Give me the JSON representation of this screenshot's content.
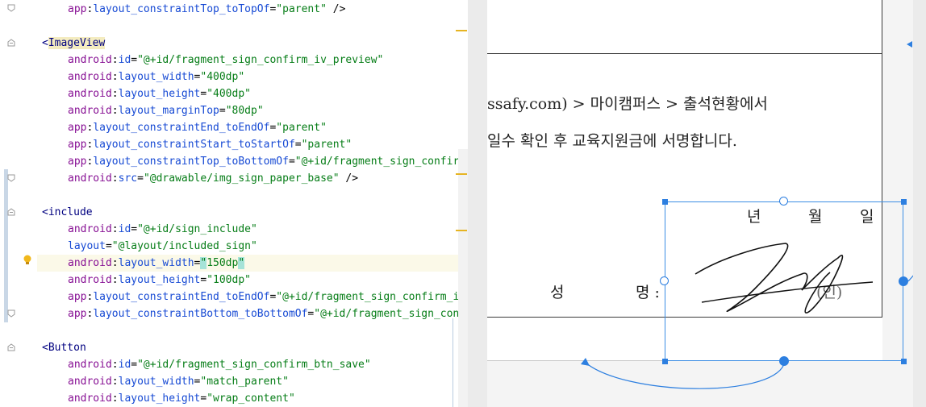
{
  "editor": {
    "lines": [
      {
        "indent": 1,
        "parts": [
          [
            "ns",
            "app"
          ],
          [
            "punct",
            ":"
          ],
          [
            "attr",
            "layout_constraintTop_toTopOf"
          ],
          [
            "punct",
            "="
          ],
          [
            "val",
            "\"parent\""
          ],
          [
            "punct",
            " />"
          ]
        ]
      },
      {
        "indent": 0,
        "parts": []
      },
      {
        "indent": 0,
        "parts": [
          [
            "tag-open",
            "<"
          ],
          [
            "tag-name-sel",
            "ImageView"
          ]
        ]
      },
      {
        "indent": 1,
        "parts": [
          [
            "ns",
            "android"
          ],
          [
            "punct",
            ":"
          ],
          [
            "attr",
            "id"
          ],
          [
            "punct",
            "="
          ],
          [
            "val",
            "\"@+id/fragment_sign_confirm_iv_preview\""
          ]
        ]
      },
      {
        "indent": 1,
        "parts": [
          [
            "ns",
            "android"
          ],
          [
            "punct",
            ":"
          ],
          [
            "attr",
            "layout_width"
          ],
          [
            "punct",
            "="
          ],
          [
            "val",
            "\"400dp\""
          ]
        ]
      },
      {
        "indent": 1,
        "parts": [
          [
            "ns",
            "android"
          ],
          [
            "punct",
            ":"
          ],
          [
            "attr",
            "layout_height"
          ],
          [
            "punct",
            "="
          ],
          [
            "val",
            "\"400dp\""
          ]
        ]
      },
      {
        "indent": 1,
        "parts": [
          [
            "ns",
            "android"
          ],
          [
            "punct",
            ":"
          ],
          [
            "attr",
            "layout_marginTop"
          ],
          [
            "punct",
            "="
          ],
          [
            "val",
            "\"80dp\""
          ]
        ]
      },
      {
        "indent": 1,
        "parts": [
          [
            "ns",
            "app"
          ],
          [
            "punct",
            ":"
          ],
          [
            "attr",
            "layout_constraintEnd_toEndOf"
          ],
          [
            "punct",
            "="
          ],
          [
            "val",
            "\"parent\""
          ]
        ]
      },
      {
        "indent": 1,
        "parts": [
          [
            "ns",
            "app"
          ],
          [
            "punct",
            ":"
          ],
          [
            "attr",
            "layout_constraintStart_toStartOf"
          ],
          [
            "punct",
            "="
          ],
          [
            "val",
            "\"parent\""
          ]
        ]
      },
      {
        "indent": 1,
        "parts": [
          [
            "ns",
            "app"
          ],
          [
            "punct",
            ":"
          ],
          [
            "attr",
            "layout_constraintTop_toBottomOf"
          ],
          [
            "punct",
            "="
          ],
          [
            "val",
            "\"@+id/fragment_sign_confir"
          ]
        ]
      },
      {
        "indent": 1,
        "parts": [
          [
            "ns",
            "android"
          ],
          [
            "punct",
            ":"
          ],
          [
            "attr",
            "src"
          ],
          [
            "punct",
            "="
          ],
          [
            "val",
            "\"@drawable/img_sign_paper_base\""
          ],
          [
            "punct",
            " />"
          ]
        ]
      },
      {
        "indent": 0,
        "parts": []
      },
      {
        "indent": 0,
        "parts": [
          [
            "tag-open",
            "<"
          ],
          [
            "tag-name",
            "include"
          ]
        ]
      },
      {
        "indent": 1,
        "parts": [
          [
            "ns",
            "android"
          ],
          [
            "punct",
            ":"
          ],
          [
            "attr",
            "id"
          ],
          [
            "punct",
            "="
          ],
          [
            "val",
            "\"@+id/sign_include\""
          ]
        ]
      },
      {
        "indent": 1,
        "parts": [
          [
            "attr",
            "layout"
          ],
          [
            "punct",
            "="
          ],
          [
            "val",
            "\"@layout/included_sign\""
          ]
        ]
      },
      {
        "indent": 1,
        "hl": true,
        "parts": [
          [
            "ns",
            "android"
          ],
          [
            "punct",
            ":"
          ],
          [
            "attr",
            "layout_width"
          ],
          [
            "punct",
            "="
          ],
          [
            "val-bm",
            "\"150dp\""
          ]
        ]
      },
      {
        "indent": 1,
        "parts": [
          [
            "ns",
            "android"
          ],
          [
            "punct",
            ":"
          ],
          [
            "attr",
            "layout_height"
          ],
          [
            "punct",
            "="
          ],
          [
            "val",
            "\"100dp\""
          ]
        ]
      },
      {
        "indent": 1,
        "parts": [
          [
            "ns",
            "app"
          ],
          [
            "punct",
            ":"
          ],
          [
            "attr",
            "layout_constraintEnd_toEndOf"
          ],
          [
            "punct",
            "="
          ],
          [
            "val",
            "\"@+id/fragment_sign_confirm_i"
          ]
        ]
      },
      {
        "indent": 1,
        "parts": [
          [
            "ns",
            "app"
          ],
          [
            "punct",
            ":"
          ],
          [
            "attr",
            "layout_constraintBottom_toBottomOf"
          ],
          [
            "punct",
            "="
          ],
          [
            "val",
            "\"@+id/fragment_sign_con"
          ]
        ]
      },
      {
        "indent": 0,
        "parts": []
      },
      {
        "indent": 0,
        "parts": [
          [
            "tag-open",
            "<"
          ],
          [
            "tag-name",
            "Button"
          ]
        ]
      },
      {
        "indent": 1,
        "parts": [
          [
            "ns",
            "android"
          ],
          [
            "punct",
            ":"
          ],
          [
            "attr",
            "id"
          ],
          [
            "punct",
            "="
          ],
          [
            "val",
            "\"@+id/fragment_sign_confirm_btn_save\""
          ]
        ]
      },
      {
        "indent": 1,
        "parts": [
          [
            "ns",
            "android"
          ],
          [
            "punct",
            ":"
          ],
          [
            "attr",
            "layout_width"
          ],
          [
            "punct",
            "="
          ],
          [
            "val",
            "\"match_parent\""
          ]
        ]
      },
      {
        "indent": 1,
        "parts": [
          [
            "ns",
            "android"
          ],
          [
            "punct",
            ":"
          ],
          [
            "attr",
            "layout_height"
          ],
          [
            "punct",
            "="
          ],
          [
            "val",
            "\"wrap_content\""
          ]
        ]
      }
    ]
  },
  "design": {
    "line1": "ssafy.com) > 마이캠퍼스 > 출석현황에서",
    "line2": "일수 확인 후 교육지원금에 서명합니다.",
    "date_year": "년",
    "date_month": "월",
    "date_day": "일",
    "name_label_1": "성",
    "name_label_2": "명 :",
    "seal": "(인)"
  },
  "colors": {
    "accent": "#2d7fe0",
    "tag": "#000080",
    "attr": "#174ad4",
    "ns": "#871094",
    "value": "#067d17"
  }
}
